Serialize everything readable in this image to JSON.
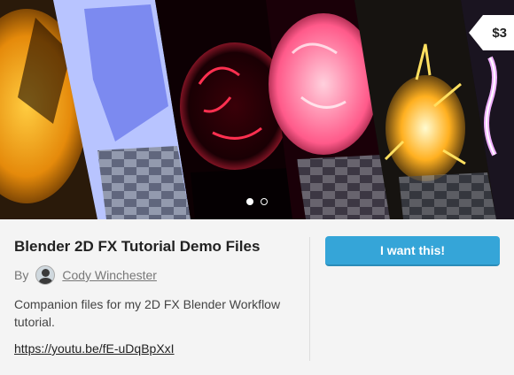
{
  "product": {
    "title": "Blender 2D FX Tutorial Demo Files",
    "price": "$3",
    "by_label": "By",
    "author_name": "Cody Winchester",
    "description": "Companion files for my 2D FX Blender Workflow tutorial.",
    "url": "https://youtu.be/fE-uDqBpXxI",
    "buy_label": "I want this!"
  },
  "carousel": {
    "slide_count": 2,
    "active_index": 0
  },
  "colors": {
    "accent": "#35a5d8",
    "background": "#f4f4f4"
  }
}
